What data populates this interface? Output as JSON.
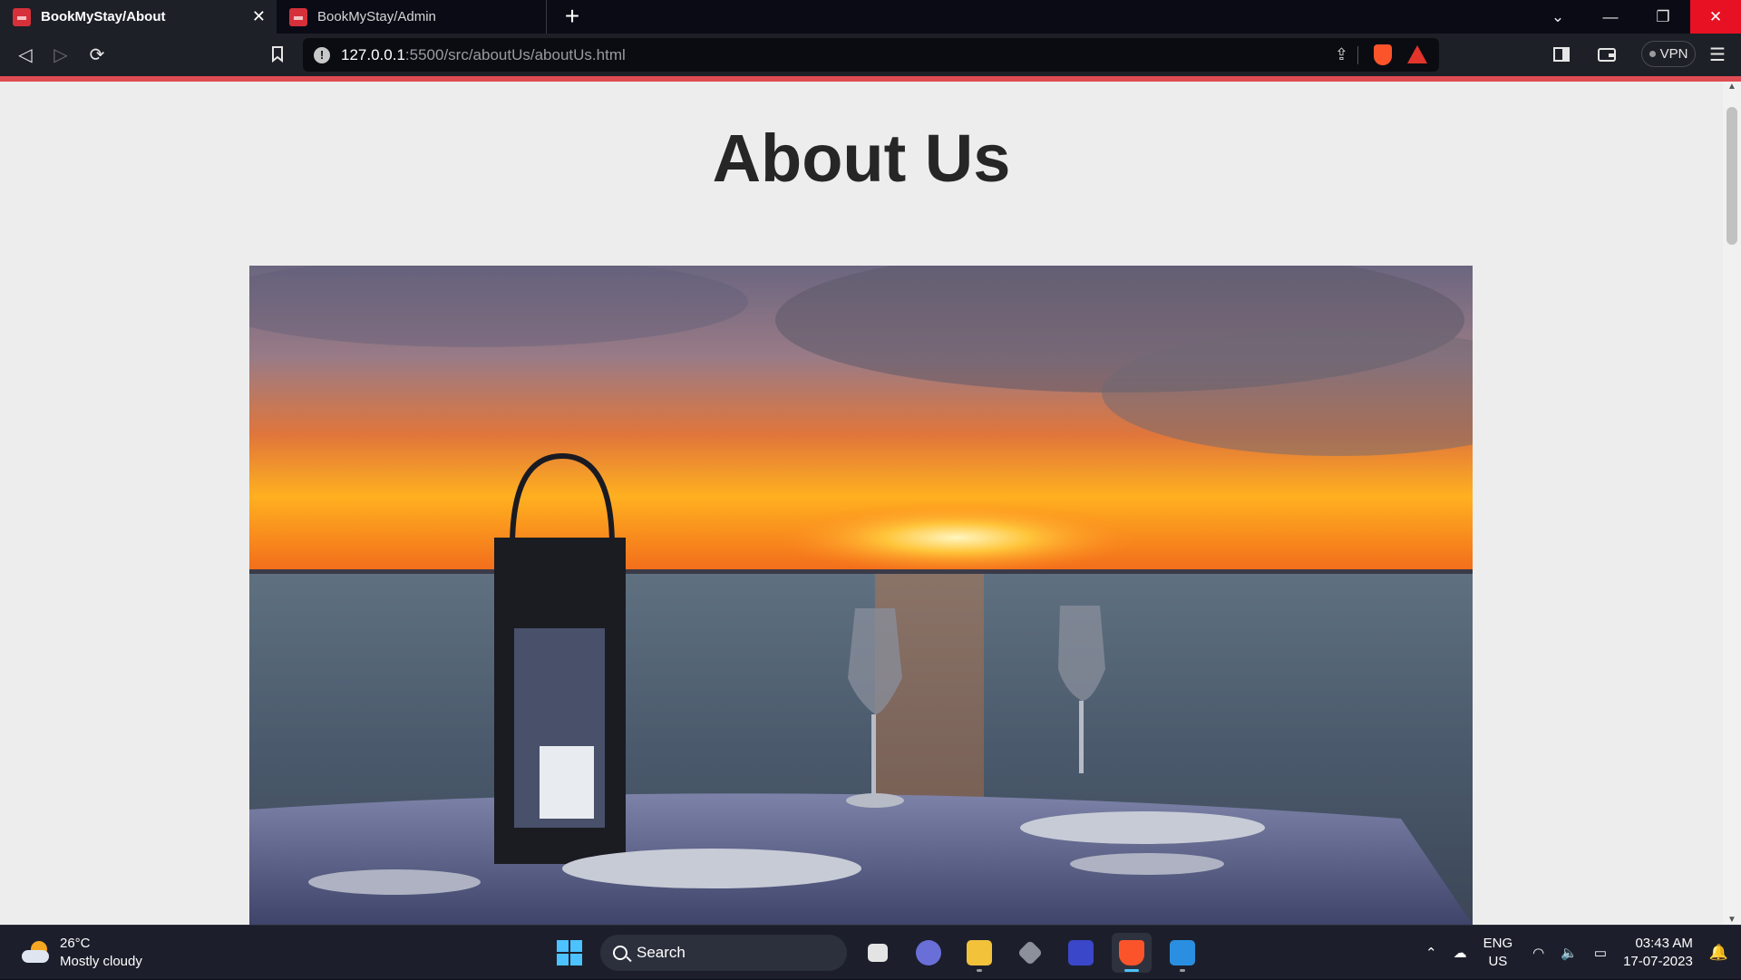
{
  "browser": {
    "tabs": [
      {
        "title": "BookMyStay/About",
        "active": true
      },
      {
        "title": "BookMyStay/Admin",
        "active": false
      }
    ],
    "new_tab_glyph": "+",
    "url": {
      "host": "127.0.0.1",
      "rest": ":5500/src/aboutUs/aboutUs.html"
    },
    "vpn_label": "VPN",
    "accent_color": "#df4b52"
  },
  "page": {
    "title": "About Us",
    "hero_image": "sunset-dinner-table-by-the-sea"
  },
  "taskbar": {
    "weather": {
      "temp": "26°C",
      "condition": "Mostly cloudy"
    },
    "search_label": "Search",
    "apps": [
      "file-explorer-icon",
      "teams-icon",
      "folder-icon",
      "unity-icon",
      "app-icon",
      "brave-icon",
      "vscode-icon"
    ],
    "language": {
      "lang": "ENG",
      "region": "US"
    },
    "clock": {
      "time": "03:43 AM",
      "date": "17-07-2023"
    }
  }
}
